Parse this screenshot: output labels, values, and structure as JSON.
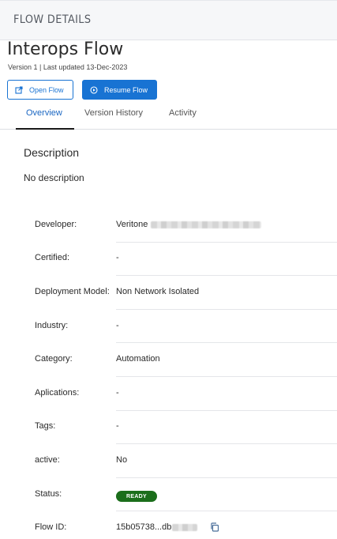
{
  "header": {
    "title": "FLOW DETAILS"
  },
  "flow": {
    "name": "Interops Flow",
    "meta": "Version 1 | Last updated 13-Dec-2023"
  },
  "actions": {
    "open_label": "Open Flow",
    "resume_label": "Resume Flow"
  },
  "tabs": [
    {
      "label": "Overview",
      "active": true
    },
    {
      "label": "Version History",
      "active": false
    },
    {
      "label": "Activity",
      "active": false
    }
  ],
  "description": {
    "heading": "Description",
    "text": "No description"
  },
  "details": {
    "developer": {
      "label": "Developer:",
      "value": "Veritone"
    },
    "certified": {
      "label": "Certified:",
      "value": "-"
    },
    "deployment": {
      "label": "Deployment Model:",
      "value": "Non Network Isolated"
    },
    "industry": {
      "label": "Industry:",
      "value": "-"
    },
    "category": {
      "label": "Category:",
      "value": "Automation"
    },
    "applications": {
      "label": "Aplications:",
      "value": "-"
    },
    "tags": {
      "label": "Tags:",
      "value": "-"
    },
    "active": {
      "label": "active:",
      "value": "No"
    },
    "status": {
      "label": "Status:",
      "value": "READY",
      "color": "#1b6e1b"
    },
    "flow_id": {
      "label": "Flow ID:",
      "value": "15b05738...db"
    }
  },
  "colors": {
    "accent": "#1873d3",
    "tab_active": "#1a66c2",
    "ready": "#1b6e1b"
  },
  "icons": {
    "open": "external-link-icon",
    "resume": "play-circle-icon",
    "copy": "copy-icon"
  }
}
